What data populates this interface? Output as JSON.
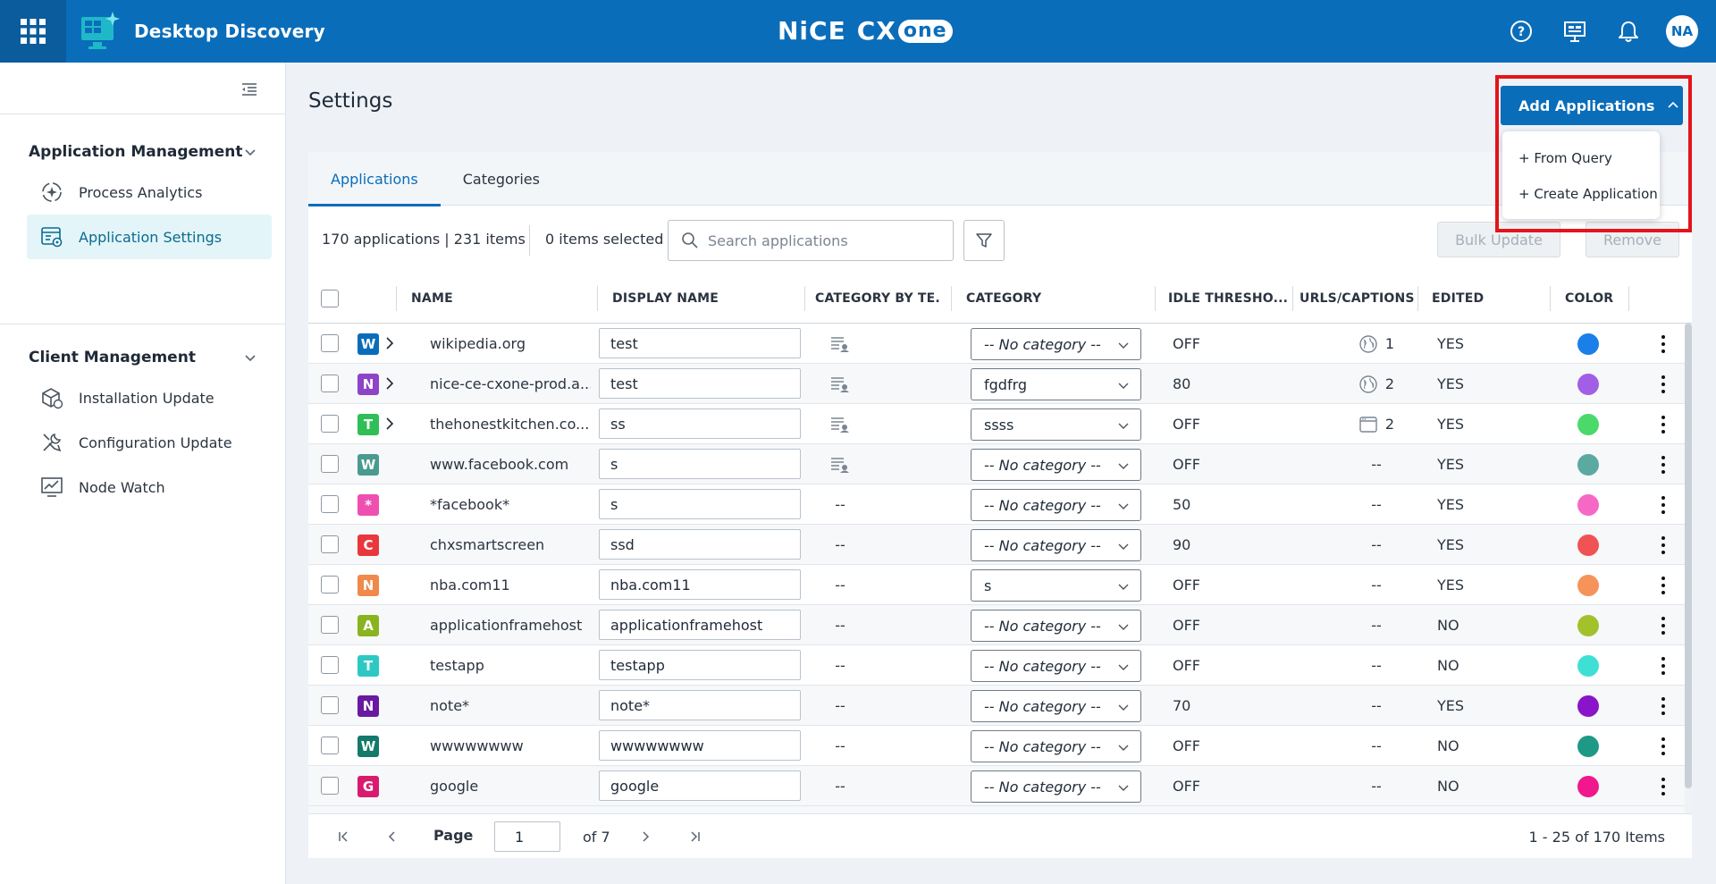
{
  "header": {
    "app_title": "Desktop Discovery",
    "brand_left": "NiCE",
    "brand_cx": "CX",
    "brand_one": "one",
    "avatar_initials": "NA",
    "icons": [
      "apps-grid-icon",
      "help-icon",
      "presentation-icon",
      "bell-icon"
    ]
  },
  "sidebar": {
    "groups": [
      {
        "label": "Application Management",
        "items": [
          {
            "label": "Process Analytics",
            "icon": "process-analytics-icon",
            "active": false
          },
          {
            "label": "Application Settings",
            "icon": "application-settings-icon",
            "active": true
          }
        ]
      },
      {
        "label": "Client Management",
        "items": [
          {
            "label": "Installation Update",
            "icon": "installation-update-icon",
            "active": false
          },
          {
            "label": "Configuration Update",
            "icon": "configuration-update-icon",
            "active": false
          },
          {
            "label": "Node Watch",
            "icon": "node-watch-icon",
            "active": false
          }
        ]
      }
    ]
  },
  "page": {
    "title": "Settings"
  },
  "tabs": [
    {
      "label": "Applications",
      "active": true
    },
    {
      "label": "Categories",
      "active": false
    }
  ],
  "toolbar": {
    "count_text": "170 applications | 231 items",
    "selected_text": "0 items selected",
    "search_placeholder": "Search applications",
    "bulk_update_label": "Bulk Update",
    "remove_label": "Remove"
  },
  "add_menu": {
    "button_label": "Add Applications",
    "items": [
      "+ From Query",
      "+ Create Application"
    ]
  },
  "table": {
    "columns": [
      "NAME",
      "DISPLAY NAME",
      "CATEGORY BY TE...",
      "CATEGORY",
      "IDLE THRESHO...",
      "URLS/CAPTIONS",
      "EDITED",
      "COLOR"
    ],
    "rows": [
      {
        "badge": "W",
        "badge_color": "#0a6dba",
        "expandable": true,
        "name": "wikipedia.org",
        "display_name": "test",
        "cat_by_te": "icon",
        "category": "-- No category --",
        "idle": "OFF",
        "url_icon": "globe",
        "url_count": "1",
        "edited": "YES",
        "color": "#1a7fe8"
      },
      {
        "badge": "N",
        "badge_color": "#8e44c7",
        "expandable": true,
        "name": "nice-ce-cxone-prod.a...",
        "display_name": "test",
        "cat_by_te": "icon",
        "category": "fgdfrg",
        "idle": "80",
        "url_icon": "globe",
        "url_count": "2",
        "edited": "YES",
        "color": "#a15fe6"
      },
      {
        "badge": "T",
        "badge_color": "#2fbf56",
        "expandable": true,
        "name": "thehonestkitchen.co...",
        "display_name": "ss",
        "cat_by_te": "icon",
        "category": "ssss",
        "idle": "OFF",
        "url_icon": "window",
        "url_count": "2",
        "edited": "YES",
        "color": "#4cd96b"
      },
      {
        "badge": "W",
        "badge_color": "#4a9a8f",
        "expandable": false,
        "name": "www.facebook.com",
        "display_name": "s",
        "cat_by_te": "icon",
        "category": "-- No category --",
        "idle": "OFF",
        "url_icon": "",
        "url_count": "--",
        "edited": "YES",
        "color": "#5ba9a0"
      },
      {
        "badge": "*",
        "badge_color": "#ef4fb0",
        "expandable": false,
        "name": "*facebook*",
        "display_name": "s",
        "cat_by_te": "--",
        "category": "-- No category --",
        "idle": "50",
        "url_icon": "",
        "url_count": "--",
        "edited": "YES",
        "color": "#f569c5"
      },
      {
        "badge": "C",
        "badge_color": "#e8383d",
        "expandable": false,
        "name": "chxsmartscreen",
        "display_name": "ssd",
        "cat_by_te": "--",
        "category": "-- No category --",
        "idle": "90",
        "url_icon": "",
        "url_count": "--",
        "edited": "YES",
        "color": "#f05353"
      },
      {
        "badge": "N",
        "badge_color": "#f0894a",
        "expandable": false,
        "name": "nba.com11",
        "display_name": "nba.com11",
        "cat_by_te": "--",
        "category": "s",
        "idle": "OFF",
        "url_icon": "",
        "url_count": "--",
        "edited": "YES",
        "color": "#f5935a"
      },
      {
        "badge": "A",
        "badge_color": "#8ab320",
        "expandable": false,
        "name": "applicationframehost",
        "display_name": "applicationframehost",
        "cat_by_te": "--",
        "category": "-- No category --",
        "idle": "OFF",
        "url_icon": "",
        "url_count": "--",
        "edited": "NO",
        "color": "#a2c12a"
      },
      {
        "badge": "T",
        "badge_color": "#2cc9c4",
        "expandable": false,
        "name": "testapp",
        "display_name": "testapp",
        "cat_by_te": "--",
        "category": "-- No category --",
        "idle": "OFF",
        "url_icon": "",
        "url_count": "--",
        "edited": "NO",
        "color": "#3ee0d6"
      },
      {
        "badge": "N",
        "badge_color": "#6a1aa0",
        "expandable": false,
        "name": "note*",
        "display_name": "note*",
        "cat_by_te": "--",
        "category": "-- No category --",
        "idle": "70",
        "url_icon": "",
        "url_count": "--",
        "edited": "YES",
        "color": "#8a14c9"
      },
      {
        "badge": "W",
        "badge_color": "#137a6a",
        "expandable": false,
        "name": "wwwwwwww",
        "display_name": "wwwwwwww",
        "cat_by_te": "--",
        "category": "-- No category --",
        "idle": "OFF",
        "url_icon": "",
        "url_count": "--",
        "edited": "NO",
        "color": "#1e9986"
      },
      {
        "badge": "G",
        "badge_color": "#d81b6f",
        "expandable": false,
        "name": "google",
        "display_name": "google",
        "cat_by_te": "--",
        "category": "-- No category --",
        "idle": "OFF",
        "url_icon": "",
        "url_count": "--",
        "edited": "NO",
        "color": "#f0188c"
      }
    ]
  },
  "pagination": {
    "page_label": "Page",
    "current_page": "1",
    "of_text": "of 7",
    "range_text": "1 - 25 of 170 Items"
  }
}
